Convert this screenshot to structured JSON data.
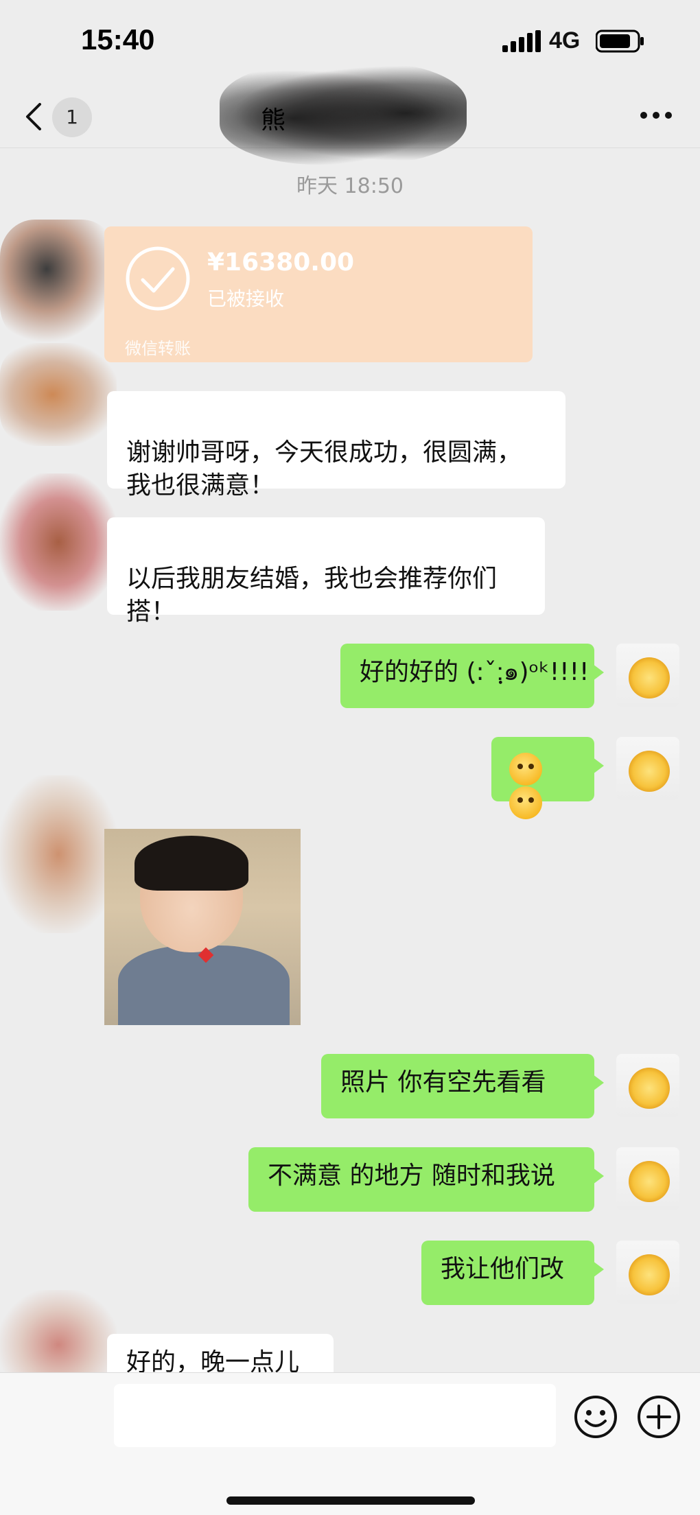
{
  "status_bar": {
    "time": "15:40",
    "network": "4G"
  },
  "nav": {
    "unread_count": "1",
    "title": "熊",
    "more_icon": "ellipsis-icon"
  },
  "chat": {
    "timestamp": "昨天 18:50",
    "transfer": {
      "amount": "¥16380.00",
      "status": "已被接收",
      "brand": "微信转账"
    },
    "messages": [
      {
        "side": "left",
        "text": "谢谢帅哥呀，今天很成功，很圆满，\n我也很满意！"
      },
      {
        "side": "left",
        "text": "以后我朋友结婚，我也会推荐你们\n搭！"
      },
      {
        "side": "right",
        "text": "好的好的 (ฺ:ˇ:ฺ๑)ᵒᵏ!!!!"
      },
      {
        "side": "right",
        "text": "",
        "emoji": [
          "wink-emoji",
          "wink-emoji"
        ]
      },
      {
        "side": "left",
        "sticker": "baby-eating-sticker"
      },
      {
        "side": "right",
        "text": "照片 你有空先看看"
      },
      {
        "side": "right",
        "text": "不满意 的地方 随时和我说"
      },
      {
        "side": "right",
        "text": "我让他们改"
      },
      {
        "side": "left",
        "text": "好的，晚一点儿"
      }
    ]
  },
  "input_bar": {
    "emoji_icon": "smiley-icon",
    "add_icon": "plus-circle-icon"
  },
  "colors": {
    "background": "#ededed",
    "self_bubble": "#95ec69",
    "other_bubble": "#ffffff",
    "transfer_card": "#fbdcc1"
  }
}
